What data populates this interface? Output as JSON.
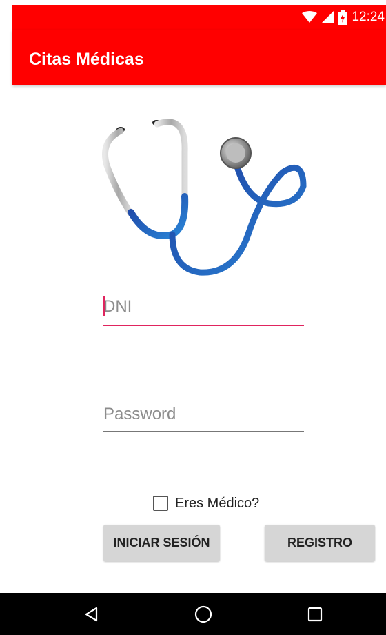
{
  "status_bar": {
    "time": "12:24",
    "icons": [
      "wifi-icon",
      "signal-icon",
      "battery-charging-icon"
    ]
  },
  "app_bar": {
    "title": "Citas Médicas",
    "background": "#ff0000"
  },
  "logo": {
    "icon": "stethoscope-icon"
  },
  "form": {
    "dni": {
      "placeholder": "DNI",
      "value": ""
    },
    "password": {
      "placeholder": "Password",
      "value": ""
    },
    "doctor_checkbox": {
      "label": "Eres Médico?",
      "checked": false
    },
    "login_button": "INICIAR SESIÓN",
    "register_button": "REGISTRO",
    "accent_color": "#e0245e"
  },
  "nav_bar": {
    "buttons": [
      "back-icon",
      "home-icon",
      "recent-apps-icon"
    ]
  }
}
